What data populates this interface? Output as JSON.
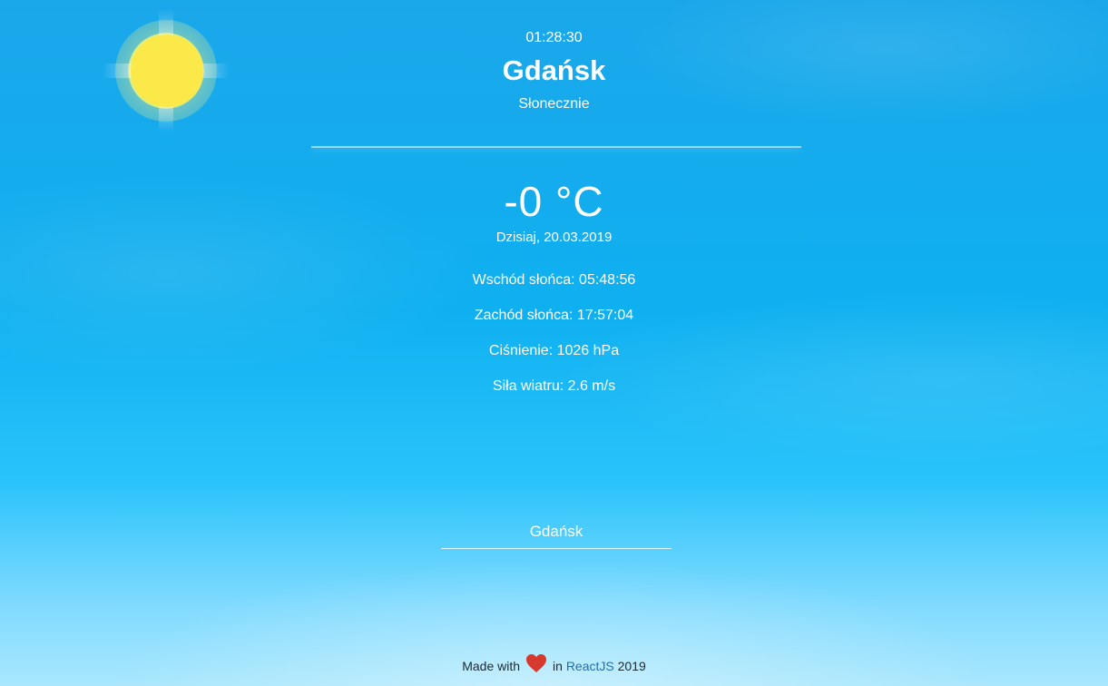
{
  "weather_icon": "sun-icon",
  "header": {
    "time": "01:28:30",
    "city": "Gdańsk",
    "description": "Słonecznie"
  },
  "current": {
    "temperature": "-0 °C",
    "date": "Dzisiaj, 20.03.2019"
  },
  "details": {
    "sunrise": "Wschód słońca: 05:48:56",
    "sunset": "Zachód słońca: 17:57:04",
    "pressure": "Ciśnienie: 1026 hPa",
    "wind": "Siła wiatru: 2.6 m/s"
  },
  "search": {
    "value": "Gdańsk"
  },
  "footer": {
    "made_with": "Made with",
    "in": "in",
    "react_link": "ReactJS",
    "year": "2019",
    "heart_icon": "heart-icon"
  },
  "colors": {
    "sky_top": "#1aa7ea",
    "sky_bottom": "#a9e7fd",
    "sun": "#fbe94a",
    "heart": "#d63a2f",
    "link": "#1f6fb0"
  }
}
